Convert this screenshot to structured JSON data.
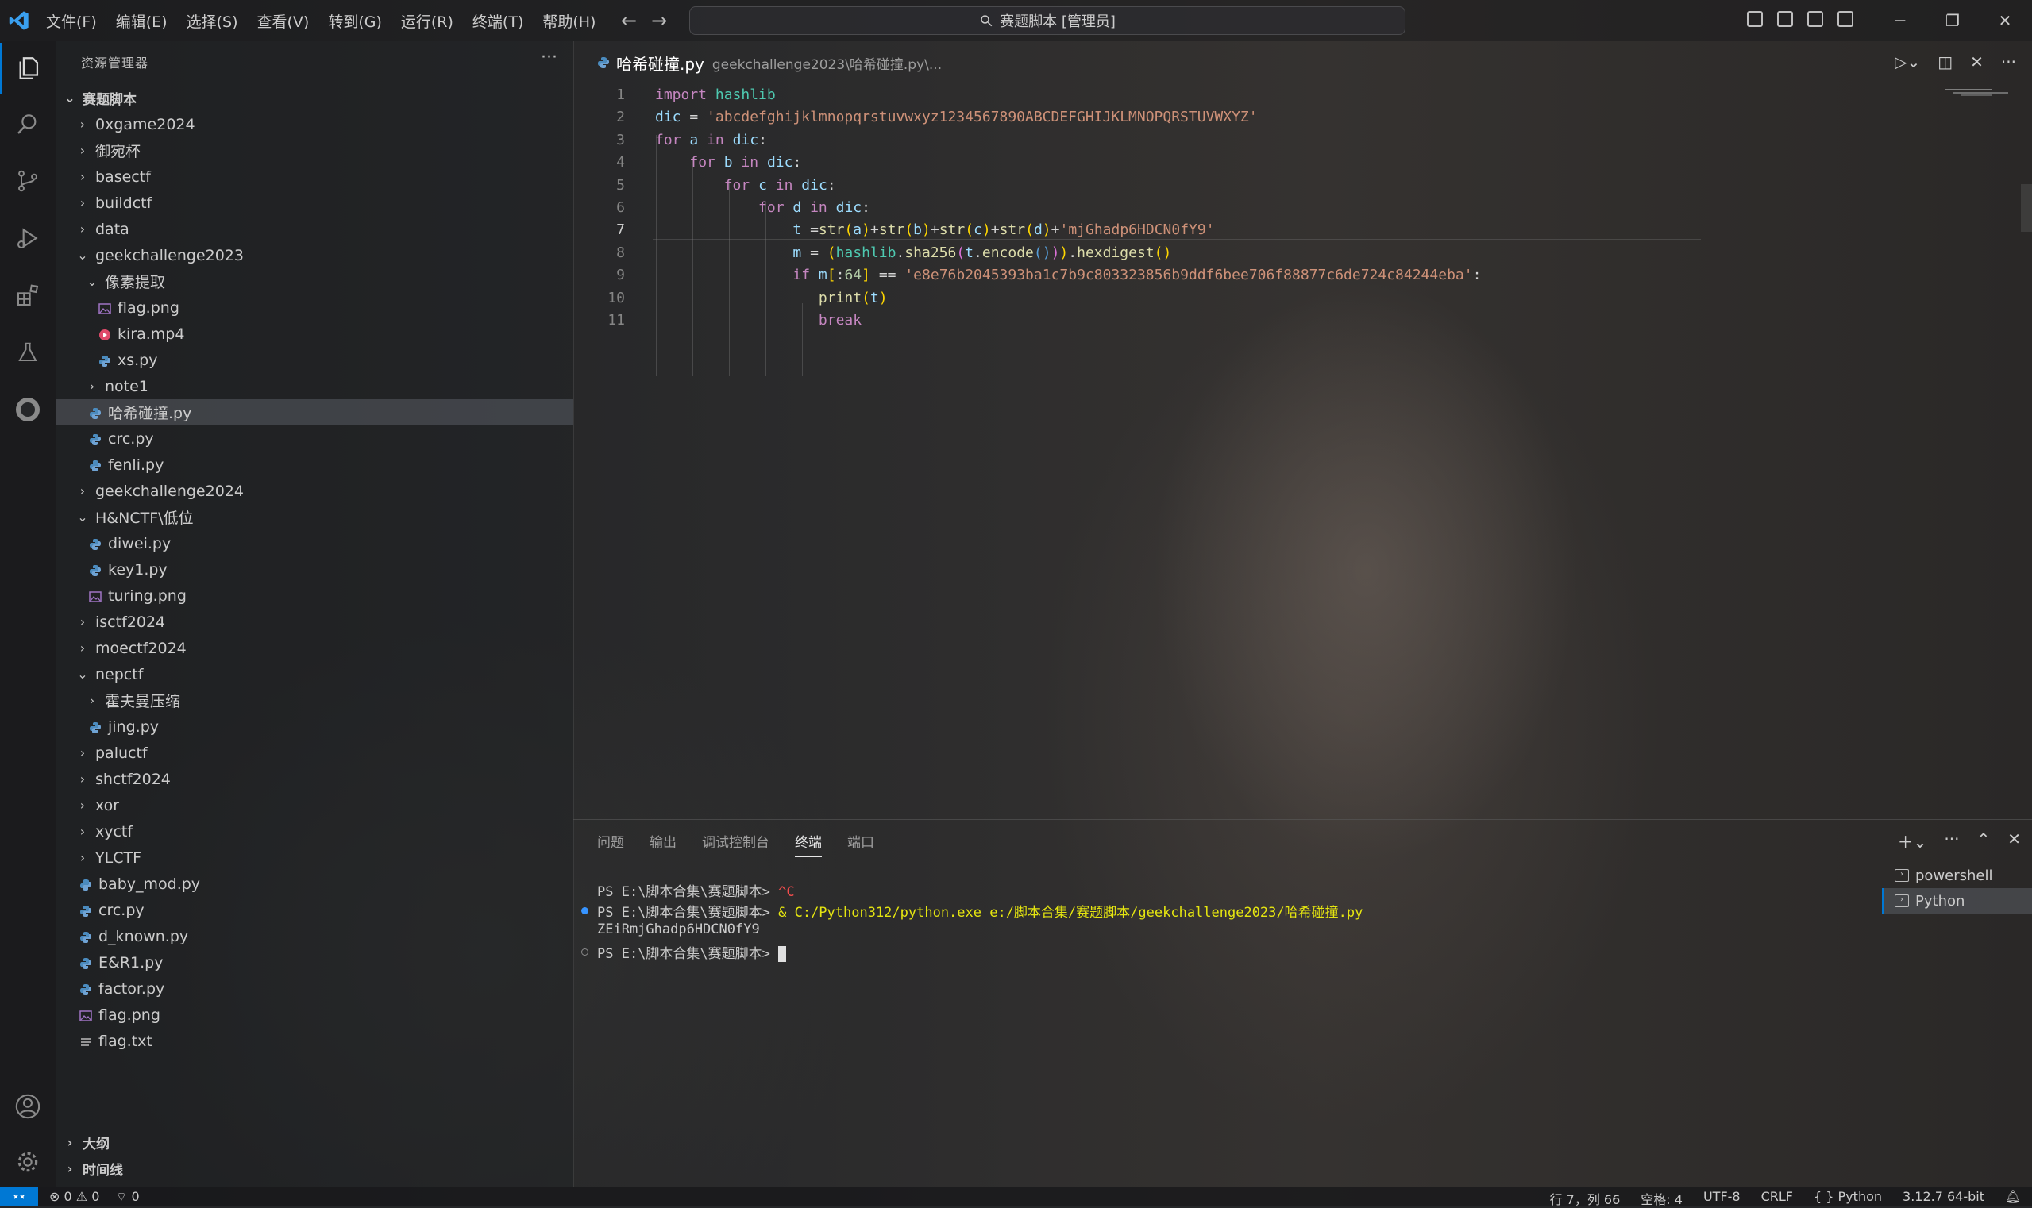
{
  "window": {
    "title": "赛题脚本 [管理员]"
  },
  "menu": [
    "文件(F)",
    "编辑(E)",
    "选择(S)",
    "查看(V)",
    "转到(G)",
    "运行(R)",
    "终端(T)",
    "帮助(H)"
  ],
  "explorer": {
    "header": "资源管理器",
    "root": "赛题脚本",
    "items": [
      {
        "label": "0xgame2024",
        "type": "folder",
        "depth": 1,
        "expanded": false
      },
      {
        "label": "御宛杯",
        "type": "folder",
        "depth": 1,
        "expanded": false
      },
      {
        "label": "basectf",
        "type": "folder",
        "depth": 1,
        "expanded": false
      },
      {
        "label": "buildctf",
        "type": "folder",
        "depth": 1,
        "expanded": false
      },
      {
        "label": "data",
        "type": "folder",
        "depth": 1,
        "expanded": false
      },
      {
        "label": "geekchallenge2023",
        "type": "folder",
        "depth": 1,
        "expanded": true
      },
      {
        "label": "像素提取",
        "type": "folder",
        "depth": 2,
        "expanded": true
      },
      {
        "label": "flag.png",
        "type": "image",
        "depth": 3
      },
      {
        "label": "kira.mp4",
        "type": "video",
        "depth": 3
      },
      {
        "label": "xs.py",
        "type": "python",
        "depth": 3
      },
      {
        "label": "note1",
        "type": "folder",
        "depth": 2,
        "expanded": false
      },
      {
        "label": "哈希碰撞.py",
        "type": "python",
        "depth": 2,
        "selected": true
      },
      {
        "label": "crc.py",
        "type": "python",
        "depth": 2
      },
      {
        "label": "fenli.py",
        "type": "python",
        "depth": 2
      },
      {
        "label": "geekchallenge2024",
        "type": "folder",
        "depth": 1,
        "expanded": false
      },
      {
        "label": "H&NCTF\\低位",
        "type": "folder",
        "depth": 1,
        "expanded": true
      },
      {
        "label": "diwei.py",
        "type": "python",
        "depth": 2
      },
      {
        "label": "key1.py",
        "type": "python",
        "depth": 2
      },
      {
        "label": "turing.png",
        "type": "image",
        "depth": 2
      },
      {
        "label": "isctf2024",
        "type": "folder",
        "depth": 1,
        "expanded": false
      },
      {
        "label": "moectf2024",
        "type": "folder",
        "depth": 1,
        "expanded": false
      },
      {
        "label": "nepctf",
        "type": "folder",
        "depth": 1,
        "expanded": true
      },
      {
        "label": "霍夫曼压缩",
        "type": "folder",
        "depth": 2,
        "expanded": false
      },
      {
        "label": "jing.py",
        "type": "python",
        "depth": 2
      },
      {
        "label": "paluctf",
        "type": "folder",
        "depth": 1,
        "expanded": false
      },
      {
        "label": "shctf2024",
        "type": "folder",
        "depth": 1,
        "expanded": false
      },
      {
        "label": "xor",
        "type": "folder",
        "depth": 1,
        "expanded": false
      },
      {
        "label": "xyctf",
        "type": "folder",
        "depth": 1,
        "expanded": false
      },
      {
        "label": "YLCTF",
        "type": "folder",
        "depth": 1,
        "expanded": false
      },
      {
        "label": "baby_mod.py",
        "type": "python",
        "depth": 1
      },
      {
        "label": "crc.py",
        "type": "python",
        "depth": 1
      },
      {
        "label": "d_known.py",
        "type": "python",
        "depth": 1
      },
      {
        "label": "E&R1.py",
        "type": "python",
        "depth": 1
      },
      {
        "label": "factor.py",
        "type": "python",
        "depth": 1
      },
      {
        "label": "flag.png",
        "type": "image",
        "depth": 1
      },
      {
        "label": "flag.txt",
        "type": "text",
        "depth": 1
      }
    ],
    "outline": "大纲",
    "timeline": "时间线"
  },
  "tab": {
    "name": "哈希碰撞.py",
    "path": "geekchallenge2023\\哈希碰撞.py\\..."
  },
  "editor": {
    "current_line": 7,
    "lines": [
      "import hashlib",
      "dic = 'abcdefghijklmnopqrstuvwxyz1234567890ABCDEFGHIJKLMNOPQRSTUVWXYZ'",
      "for a in dic:",
      "    for b in dic:",
      "        for c in dic:",
      "            for d in dic:",
      "                t =str(a)+str(b)+str(c)+str(d)+'mjGhadp6HDCN0fY9'",
      "                m = (hashlib.sha256(t.encode())).hexdigest()",
      "                if m[:64] == 'e8e76b2045393ba1c7b9c803323856b9ddf6bee706f88877c6de724c84244eba':",
      "                   print(t)",
      "                   break"
    ]
  },
  "panel": {
    "tabs": [
      "问题",
      "输出",
      "调试控制台",
      "终端",
      "端口"
    ],
    "active_tab": "终端",
    "terminal_lines": [
      {
        "prompt": "PS E:\\脚本合集\\赛题脚本> ",
        "cmd": "^C"
      },
      {
        "prompt": "PS E:\\脚本合集\\赛题脚本> ",
        "cmd": "& C:/Python312/python.exe e:/脚本合集/赛题脚本/geekchallenge2023/哈希碰撞.py"
      },
      {
        "prompt": "",
        "cmd": "ZEiRmjGhadp6HDCN0fY9"
      },
      {
        "prompt": "PS E:\\脚本合集\\赛题脚本> ",
        "cmd": ""
      }
    ],
    "terminals": [
      "powershell",
      "Python"
    ],
    "active_terminal": "Python"
  },
  "statusbar": {
    "errors": "0",
    "warnings": "0",
    "ports": "0",
    "position": "行 7，列 66",
    "spaces": "空格: 4",
    "encoding": "UTF-8",
    "eol": "CRLF",
    "language": "Python",
    "interpreter": "3.12.7 64-bit"
  },
  "colors": {
    "accent": "#0078d4",
    "python_icon": "#4b8bbe",
    "image_icon": "#a074c4",
    "video_icon": "#e04a6a"
  }
}
